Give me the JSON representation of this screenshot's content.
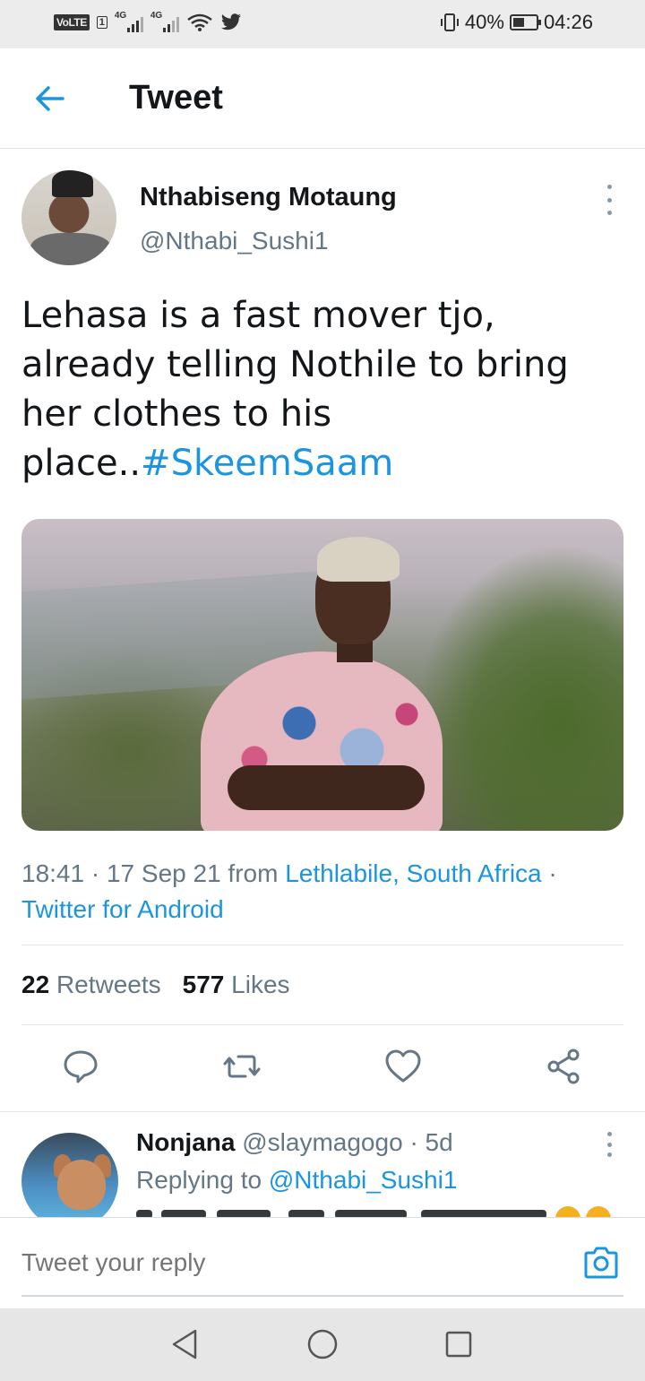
{
  "status_bar": {
    "volte": "VoLTE",
    "sim": "1",
    "network1": "4G",
    "network2": "4G",
    "battery": "40%",
    "time": "04:26"
  },
  "header": {
    "title": "Tweet"
  },
  "tweet": {
    "author_name": "Nthabiseng Motaung",
    "author_handle": "@Nthabi_Sushi1",
    "text": "Lehasa is a fast mover tjo, already telling Nothile to bring her clothes to his place..",
    "hashtag": "#SkeemSaam",
    "time": "18:41",
    "date": "17 Sep 21",
    "from_label": "from",
    "location": "Lethlabile, South Africa",
    "separator": "·",
    "client": "Twitter for Android",
    "retweets_count": "22",
    "retweets_label": "Retweets",
    "likes_count": "577",
    "likes_label": "Likes"
  },
  "actions": {
    "reply_icon": "comment-icon",
    "retweet_icon": "retweet-icon",
    "like_icon": "heart-icon",
    "share_icon": "share-icon"
  },
  "reply": {
    "author_name": "Nonjana",
    "author_handle": "@slaymagogo",
    "age": "5d",
    "replying_label": "Replying to",
    "replying_handle": "@Nthabi_Sushi1"
  },
  "composer": {
    "placeholder": "Tweet your reply"
  },
  "colors": {
    "accent": "#1b95e0",
    "text": "#14171a",
    "secondary": "#657786",
    "divider": "#e1e8ed"
  }
}
